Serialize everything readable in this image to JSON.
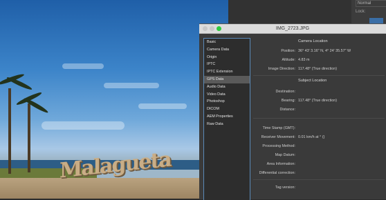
{
  "dialog": {
    "title": "IMG_2723.JPG",
    "sidebar": {
      "items": [
        {
          "label": "Basic"
        },
        {
          "label": "Camera Data"
        },
        {
          "label": "Origin"
        },
        {
          "label": "IPTC"
        },
        {
          "label": "IPTC Extension"
        },
        {
          "label": "GPS Data",
          "selected": true
        },
        {
          "label": "Audio Data"
        },
        {
          "label": "Video Data"
        },
        {
          "label": "Photoshop"
        },
        {
          "label": "DICOM"
        },
        {
          "label": "AEM Properties"
        },
        {
          "label": "Raw Data"
        }
      ]
    },
    "camera_location": {
      "heading": "Camera Location",
      "position_label": "Position:",
      "position_value": "36° 43' 3.16\" N, 4° 24' 35.57\" W",
      "altitude_label": "Altitude:",
      "altitude_value": "4.83 m",
      "image_direction_label": "Image Direction:",
      "image_direction_value": "117.48° (True direction)"
    },
    "subject_location": {
      "heading": "Subject Location",
      "destination_label": "Destination:",
      "destination_value": "",
      "bearing_label": "Bearing:",
      "bearing_value": "117.48° (True direction)",
      "distance_label": "Distance:",
      "distance_value": ""
    },
    "other": {
      "time_stamp_label": "Time Stamp (GMT):",
      "time_stamp_value": "",
      "receiver_movement_label": "Receiver Movement:",
      "receiver_movement_value": "0.01 km/h at ° ()",
      "processing_method_label": "Processing Method:",
      "processing_method_value": "",
      "map_datum_label": "Map Datum:",
      "map_datum_value": "",
      "area_information_label": "Area Information:",
      "area_information_value": "",
      "differential_correction_label": "Differential correction:",
      "differential_correction_value": "",
      "tag_version_label": "Tag version:",
      "tag_version_value": ""
    }
  },
  "photoshop_panel": {
    "blend_mode": "Normal",
    "lock_label": "Lock:"
  },
  "photo": {
    "sign_text": "Malagueta"
  },
  "colors": {
    "dialog_bg": "#3a3a3a",
    "sidebar_border": "#5a8ab8",
    "selected_item": "#5a5a5a",
    "maximize_button": "#2ecc40"
  }
}
